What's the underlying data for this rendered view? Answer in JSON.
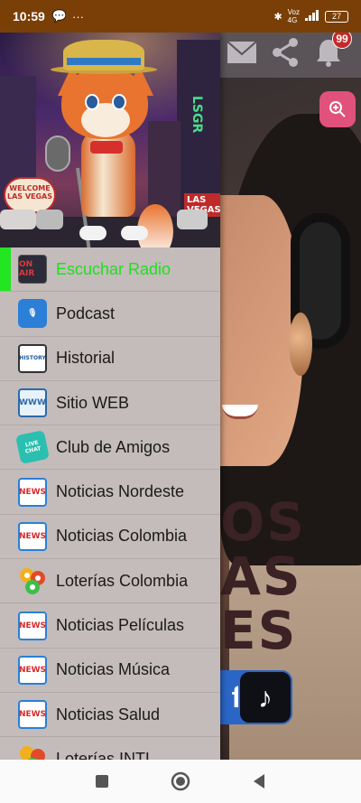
{
  "status_bar": {
    "time": "10:59",
    "dots": "···",
    "network_label_top": "Voz",
    "network_label_bottom": "4G",
    "battery": "27"
  },
  "toolbar": {
    "notification_count": "99",
    "mail_icon": "mail-icon",
    "share_icon": "share-icon",
    "bell_icon": "bell-icon"
  },
  "background": {
    "promo_lines": [
      "OS",
      "AS",
      "ES"
    ]
  },
  "drawer": {
    "active_color": "#22e622",
    "items": [
      {
        "label": "Escuchar Radio",
        "icon": "on-air-radio-icon",
        "icon_text": "ON AIR"
      },
      {
        "label": "Podcast",
        "icon": "podcast-icon",
        "icon_text": "🎙"
      },
      {
        "label": "Historial",
        "icon": "history-icon",
        "icon_text": "HISTORY"
      },
      {
        "label": "Sitio WEB",
        "icon": "website-icon",
        "icon_text": "WWW"
      },
      {
        "label": "Club de Amigos",
        "icon": "live-chat-icon",
        "icon_text": "LIVE CHAT"
      },
      {
        "label": "Noticias Nordeste",
        "icon": "news-icon",
        "icon_text": "NEWS"
      },
      {
        "label": "Noticias Colombia",
        "icon": "news-icon",
        "icon_text": "NEWS"
      },
      {
        "label": "Loterías Colombia",
        "icon": "lottery-balls-icon",
        "icon_text": ""
      },
      {
        "label": "Noticias Películas",
        "icon": "news-icon",
        "icon_text": "NEWS"
      },
      {
        "label": "Noticias Música",
        "icon": "news-icon",
        "icon_text": "NEWS"
      },
      {
        "label": "Noticias Salud",
        "icon": "news-icon",
        "icon_text": "NEWS"
      },
      {
        "label": "Loterías INTL",
        "icon": "lottery-balls-icon",
        "icon_text": ""
      }
    ],
    "header_sign_left": "WELCOME LAS VEGAS",
    "header_sign_right": "LAS VEGAS"
  }
}
